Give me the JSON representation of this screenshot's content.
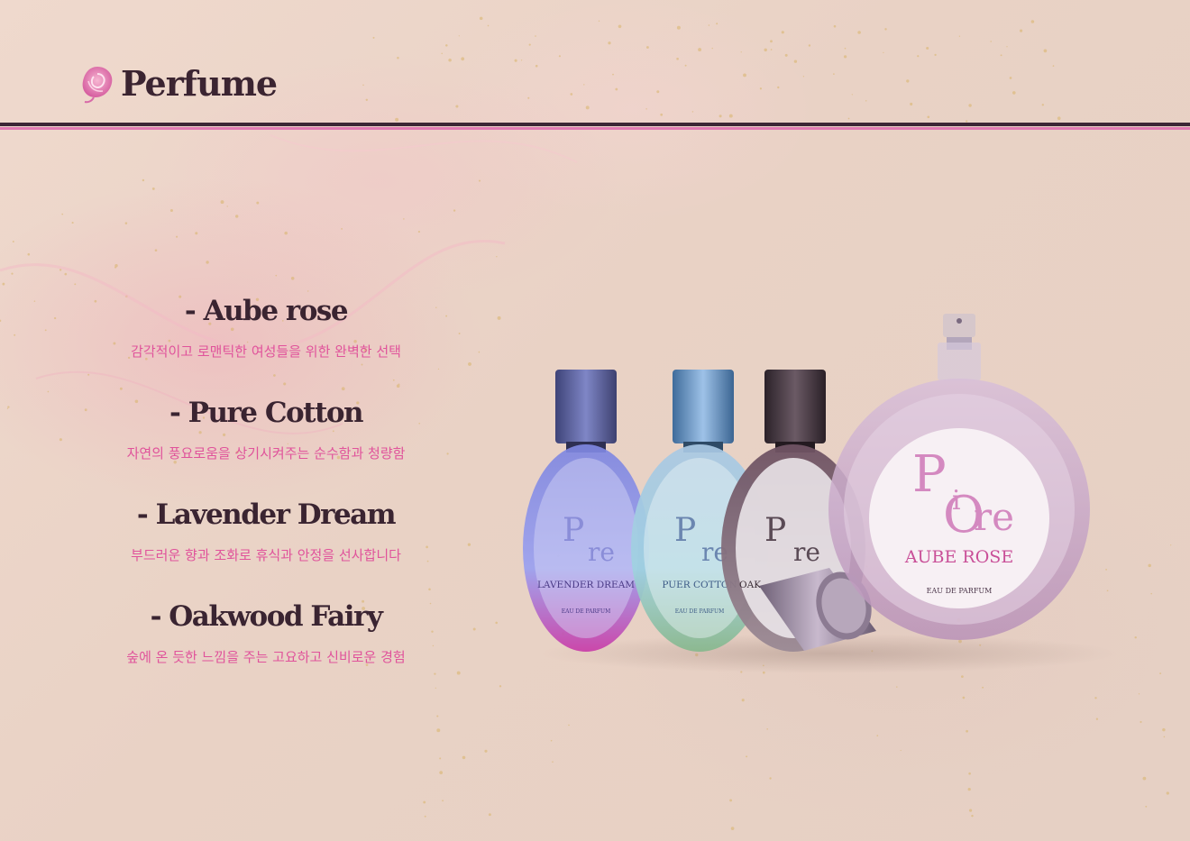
{
  "brand": {
    "name": "Perfume",
    "icon": "rose-icon"
  },
  "colors": {
    "background": "#ecd6c9",
    "dark_rule": "#3c2635",
    "accent_pink": "#e07ab2",
    "heading": "#3a2431",
    "description": "#e0539b"
  },
  "products": [
    {
      "name": "- Aube rose",
      "description": "감각적이고 로맨틱한 여성들을 위한 완벽한 선택"
    },
    {
      "name": "- Pure Cotton",
      "description": "자연의 풍요로움을 상기시켜주는 순수함과 청량함"
    },
    {
      "name": "- Lavender Dream",
      "description": "부드러운 향과 조화로 휴식과 안정을 선사합니다"
    },
    {
      "name": "- Oakwood Fairy",
      "description": "숲에 온 듯한 느낌을 주는 고요하고 신비로운 경험"
    }
  ],
  "bottles": {
    "brand_mark_p": "P",
    "brand_mark_i": "i",
    "brand_mark_o": "O",
    "brand_mark_re": "re",
    "small": [
      {
        "label": "LAVENDER DREAM",
        "sub": "EAU DE PARFUM"
      },
      {
        "label": "PUER COTTON",
        "sub": "EAU DE PARFUM"
      },
      {
        "label": "OAK",
        "sub": ""
      }
    ],
    "large": {
      "label": "AUBE ROSE",
      "sub": "EAU DE PARFUM"
    }
  }
}
